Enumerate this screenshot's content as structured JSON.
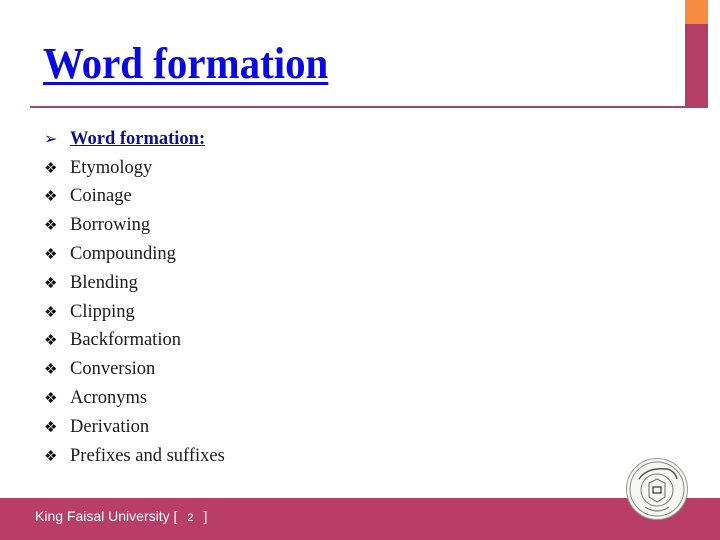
{
  "slide": {
    "title": "Word formation",
    "heading_item": {
      "bullet_icon": "arrow-bullet-icon",
      "label": "Word formation:"
    },
    "items": [
      {
        "bullet_icon": "diamond-bullet-icon",
        "label": "Etymology"
      },
      {
        "bullet_icon": "diamond-bullet-icon",
        "label": "Coinage"
      },
      {
        "bullet_icon": "diamond-bullet-icon",
        "label": "Borrowing"
      },
      {
        "bullet_icon": "diamond-bullet-icon",
        "label": "Compounding"
      },
      {
        "bullet_icon": "diamond-bullet-icon",
        "label": "Blending"
      },
      {
        "bullet_icon": "diamond-bullet-icon",
        "label": "Clipping"
      },
      {
        "bullet_icon": "diamond-bullet-icon",
        "label": "Backformation"
      },
      {
        "bullet_icon": "diamond-bullet-icon",
        "label": "Conversion"
      },
      {
        "bullet_icon": "diamond-bullet-icon",
        "label": "Acronyms"
      },
      {
        "bullet_icon": "diamond-bullet-icon",
        "label": "Derivation"
      },
      {
        "bullet_icon": "diamond-bullet-icon",
        "label": "Prefixes and suffixes"
      }
    ]
  },
  "bullets": {
    "arrow": "➢",
    "diamond": "❖"
  },
  "footer": {
    "institution": "King Faisal University",
    "bracket_open": "[",
    "page_number": "2",
    "bracket_close": "]",
    "logo_icon": "university-seal-logo"
  },
  "colors": {
    "title": "#0a0ae0",
    "footer_band": "#b83d67",
    "accent_orange": "#f58b40",
    "accent_magenta": "#b43e66"
  }
}
